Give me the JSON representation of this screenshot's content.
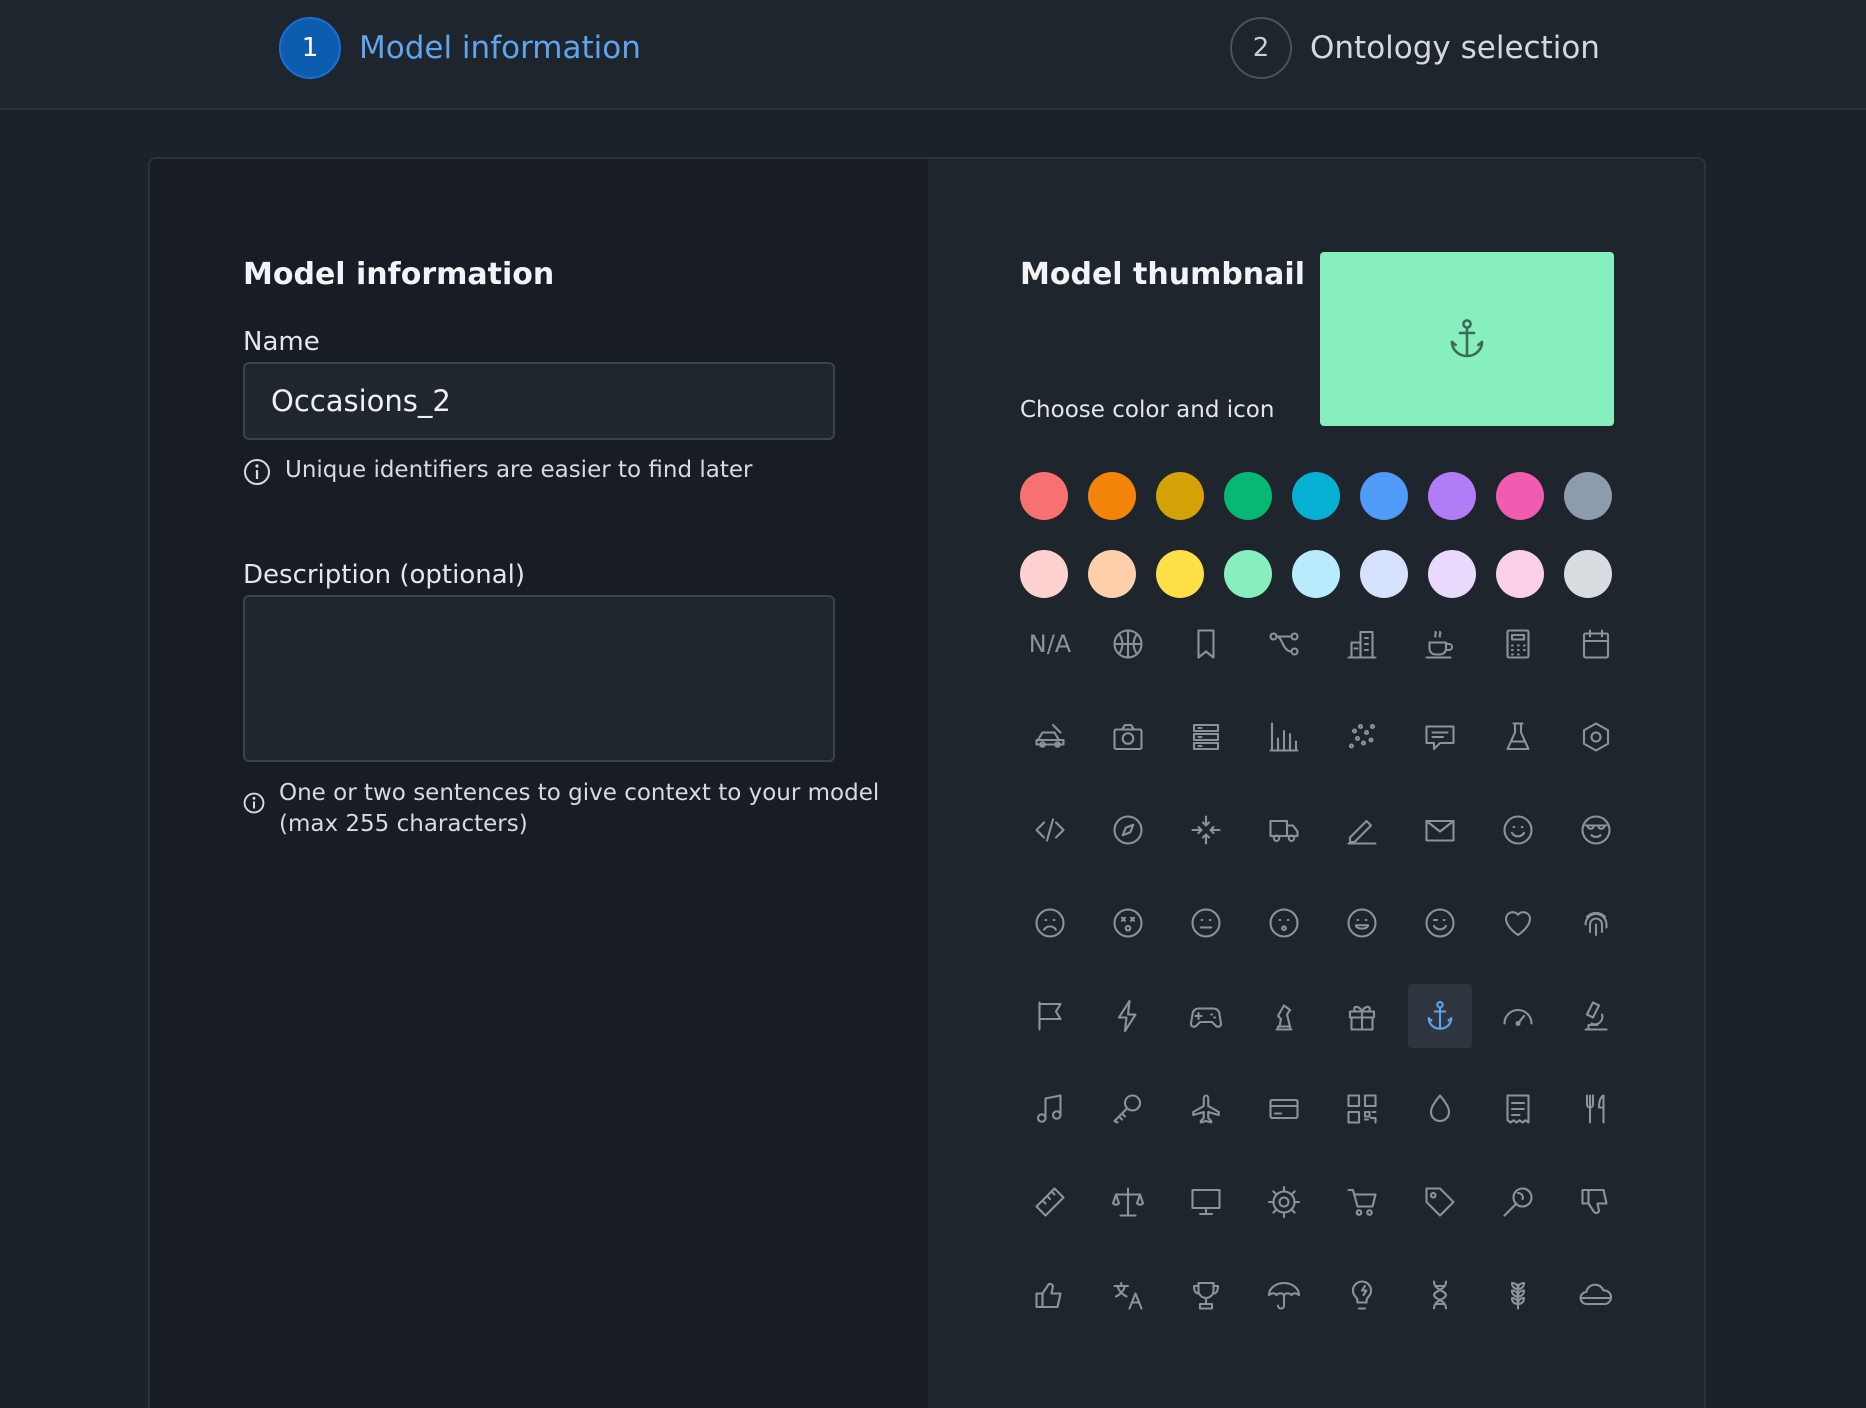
{
  "steps": [
    {
      "number": "1",
      "label": "Model information",
      "state": "active"
    },
    {
      "number": "2",
      "label": "Ontology selection",
      "state": "inactive"
    }
  ],
  "form": {
    "title": "Model information",
    "name_label": "Name",
    "name_value": "Occasions_2",
    "name_hint": "Unique identifiers are easier to find later",
    "description_label": "Description (optional)",
    "description_value": "",
    "description_hint_line1": "One or two sentences to give context to your model",
    "description_hint_line2": "(max 255 characters)"
  },
  "thumbnail": {
    "title": "Model thumbnail",
    "subtitle": "Choose color and icon",
    "selected_color": "#86efbd",
    "selected_icon": "anchor-icon",
    "icon_color": "#3e6a58"
  },
  "colors": {
    "row1": [
      "#f87171",
      "#f28509",
      "#d4a106",
      "#07b873",
      "#08b1d4",
      "#4e9cf7",
      "#b07df7",
      "#f25cb0",
      "#8d9bae"
    ],
    "row2": [
      "#fdd1cf",
      "#fdd0ab",
      "#fde047",
      "#86efbd",
      "#b8ecfd",
      "#d6e2fd",
      "#e8d9fd",
      "#fbcfe6",
      "#d8dce1"
    ]
  },
  "icons": [
    {
      "name": "na-icon",
      "text": "N/A"
    },
    {
      "name": "basketball-icon"
    },
    {
      "name": "bookmark-icon"
    },
    {
      "name": "flow-icon"
    },
    {
      "name": "building-icon"
    },
    {
      "name": "coffee-icon"
    },
    {
      "name": "calculator-icon"
    },
    {
      "name": "calendar-icon"
    },
    {
      "name": "car-icon"
    },
    {
      "name": "camera-icon"
    },
    {
      "name": "server-icon"
    },
    {
      "name": "bar-chart-icon"
    },
    {
      "name": "scatter-icon"
    },
    {
      "name": "chat-icon"
    },
    {
      "name": "flask-icon"
    },
    {
      "name": "cube-icon"
    },
    {
      "name": "code-icon"
    },
    {
      "name": "compass-icon"
    },
    {
      "name": "collapse-icon"
    },
    {
      "name": "truck-icon"
    },
    {
      "name": "pencil-icon"
    },
    {
      "name": "mail-icon"
    },
    {
      "name": "smile-icon"
    },
    {
      "name": "cool-face-icon"
    },
    {
      "name": "sad-face-icon"
    },
    {
      "name": "dizzy-face-icon"
    },
    {
      "name": "neutral-face-icon"
    },
    {
      "name": "surprised-face-icon"
    },
    {
      "name": "happy-face-icon"
    },
    {
      "name": "wink-face-icon"
    },
    {
      "name": "heart-icon"
    },
    {
      "name": "fingerprint-icon"
    },
    {
      "name": "flag-icon"
    },
    {
      "name": "lightning-icon"
    },
    {
      "name": "gamepad-icon"
    },
    {
      "name": "chess-icon"
    },
    {
      "name": "gift-icon"
    },
    {
      "name": "anchor-icon",
      "selected": true
    },
    {
      "name": "gauge-icon"
    },
    {
      "name": "microscope-icon"
    },
    {
      "name": "music-icon"
    },
    {
      "name": "key-icon"
    },
    {
      "name": "plane-icon"
    },
    {
      "name": "card-icon"
    },
    {
      "name": "qr-code-icon"
    },
    {
      "name": "drop-icon"
    },
    {
      "name": "receipt-icon"
    },
    {
      "name": "restaurant-icon"
    },
    {
      "name": "ruler-icon"
    },
    {
      "name": "scale-icon"
    },
    {
      "name": "monitor-icon"
    },
    {
      "name": "gear-icon"
    },
    {
      "name": "cart-icon"
    },
    {
      "name": "tag-icon"
    },
    {
      "name": "lollipop-icon"
    },
    {
      "name": "thumbs-down-icon"
    },
    {
      "name": "thumbs-up-icon"
    },
    {
      "name": "translate-icon"
    },
    {
      "name": "trophy-icon"
    },
    {
      "name": "umbrella-icon"
    },
    {
      "name": "lightbulb-icon"
    },
    {
      "name": "dna-icon"
    },
    {
      "name": "wheat-icon"
    },
    {
      "name": "cloud-icon"
    }
  ]
}
